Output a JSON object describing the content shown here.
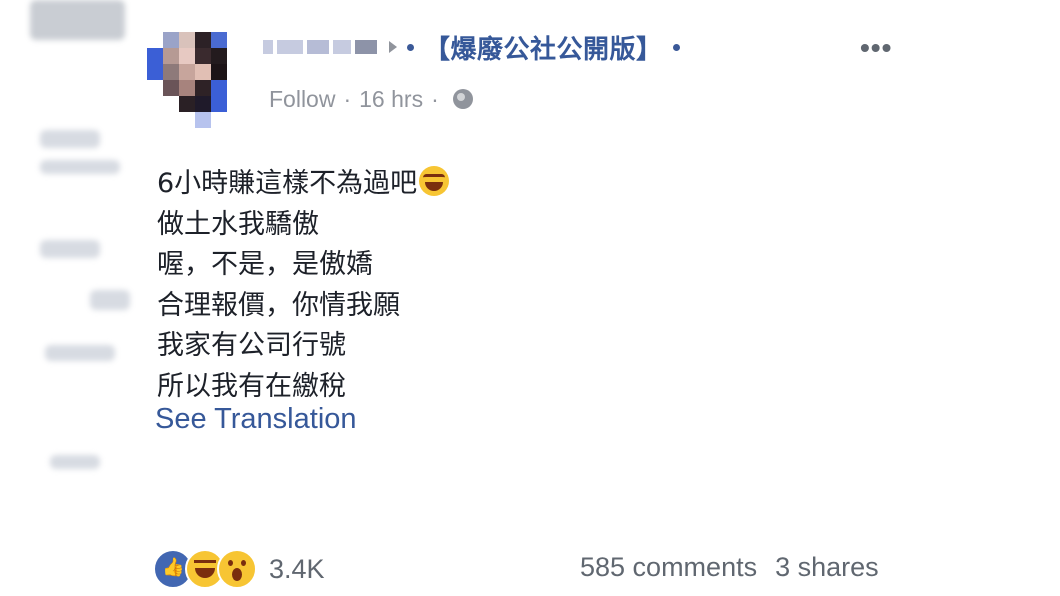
{
  "post": {
    "group_name": "【爆廢公社公開版】",
    "follow_label": "Follow",
    "separator": "·",
    "time_ago": "16 hrs",
    "privacy_icon": "globe-icon",
    "more_label": "•••",
    "body_lines": [
      "6小時賺這樣不為過吧",
      "做土水我驕傲",
      "喔，不是，是傲嬌",
      "合理報價，你情我願",
      "我家有公司行號",
      "所以我有在繳稅"
    ],
    "see_translation": "See Translation"
  },
  "reactions": {
    "icons": [
      "like-icon",
      "haha-icon",
      "wow-icon"
    ],
    "count": "3.4K",
    "comments": "585 comments",
    "shares": "3 shares"
  },
  "colors": {
    "link": "#365899",
    "meta": "#90949c",
    "text": "#1d2129",
    "like": "#4267b2",
    "emoji": "#f7c533"
  }
}
